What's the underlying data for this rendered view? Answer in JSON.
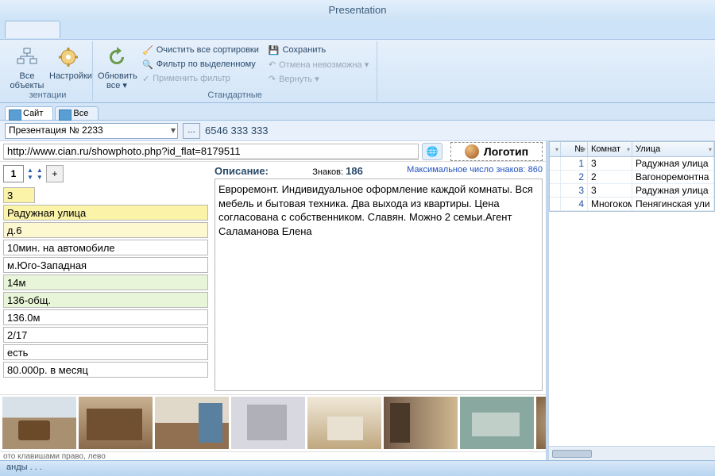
{
  "title": "Presentation",
  "ribbon": {
    "group1_caption": "зентации",
    "btn_all_objects": "Все\nобъекты",
    "btn_settings": "Настройки",
    "btn_refresh": "Обновить\nвсе ▾",
    "btn_clear_sort": "Очистить все сортировки",
    "btn_filter_sel": "Фильтр по выделенному",
    "btn_apply_filter": "Применить фильтр",
    "btn_save": "Сохранить",
    "btn_undo": "Отмена невозможна ▾",
    "btn_redo": "Вернуть ▾",
    "group2_caption": "Стандартные"
  },
  "doctabs": {
    "tab1": "Сайт",
    "tab2": "Все"
  },
  "toolbar": {
    "combo_value": "Презентация № 2233",
    "phone": "6546 333 333"
  },
  "url": "http://www.cian.ru/showphoto.php?id_flat=8179511",
  "logo_text": "Логотип",
  "pager_value": "1",
  "fields": {
    "f0": "3",
    "f1": "Радужная улица",
    "f2": "д.6",
    "f3": "10мин. на автомобиле",
    "f4": "м.Юго-Западная",
    "f5": "14м",
    "f6": "136-общ.",
    "f7": "136.0м",
    "f8": "2/17",
    "f9": "есть",
    "f10": "80.000р. в месяц"
  },
  "desc": {
    "label": "Описание:",
    "count_label": "Знаков:",
    "count": "186",
    "max_label": "Максимальное число знаков: 860",
    "text": "Евроремонт. Индивидуальное оформление каждой комнаты. Вся мебель и бытовая техника. Два выхода из квартиры. Цена согласована с собственником. Славян. Можно 2 семьи.Агент Саламанова Елена"
  },
  "hint": "ото клавишами право, лево",
  "rtable": {
    "h_num": "№",
    "h_rooms": "Комнат",
    "h_street": "Улица",
    "rows": [
      {
        "n": "1",
        "rooms": "3",
        "street": "Радужная улица"
      },
      {
        "n": "2",
        "rooms": "2",
        "street": "Вагоноремонтна"
      },
      {
        "n": "3",
        "rooms": "3",
        "street": "Радужная улица"
      },
      {
        "n": "4",
        "rooms": "Многоком",
        "street": "Пенягинская ули"
      }
    ]
  },
  "status": "анды . . ."
}
